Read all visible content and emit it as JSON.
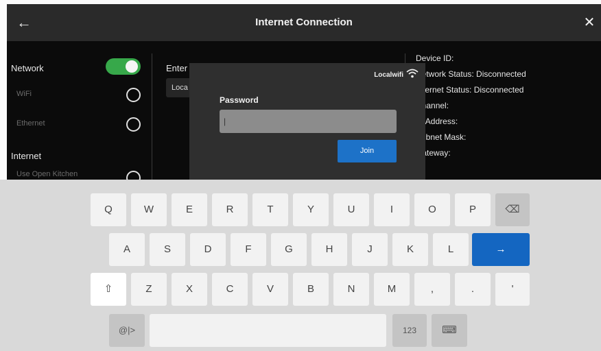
{
  "header": {
    "title": "Internet Connection",
    "back_icon": "←",
    "close_icon": "✕"
  },
  "left_panel": {
    "network_label": "Network",
    "network_toggle_on": true,
    "wifi_label": "WiFi",
    "ethernet_label": "Ethernet",
    "internet_label": "Internet",
    "open_kitchen_label": "Use Open Kitchen"
  },
  "middle_panel": {
    "enter_label": "Enter",
    "network_value": "Loca"
  },
  "device_info": {
    "device_id": "Device ID:",
    "network_status": "Network Status: Disconnected",
    "internet_status": "Internet Status: Disconnected",
    "channel": "Channel:",
    "ip_address": "IP Address:",
    "subnet_mask": "Subnet Mask:",
    "gateway": "Gateway:"
  },
  "dialog": {
    "ssid": "Localwifi",
    "password_label": "Password",
    "password_value": "|",
    "join_label": "Join"
  },
  "keyboard": {
    "row1": [
      "Q",
      "W",
      "E",
      "R",
      "T",
      "Y",
      "U",
      "I",
      "O",
      "P"
    ],
    "backspace_icon": "⌫",
    "row2": [
      "A",
      "S",
      "D",
      "F",
      "G",
      "H",
      "J",
      "K",
      "L"
    ],
    "enter_icon": "→",
    "shift_icon": "⇧",
    "row3": [
      "Z",
      "X",
      "C",
      "V",
      "B",
      "N",
      "M",
      ",",
      ".",
      "'"
    ],
    "symbols_label": "@|>",
    "numbers_label": "123",
    "hide_keyboard_icon": "⌨"
  },
  "colors": {
    "toggle_on": "#37a84a",
    "join_button": "#1d72c8",
    "enter_key": "#1466c1"
  }
}
